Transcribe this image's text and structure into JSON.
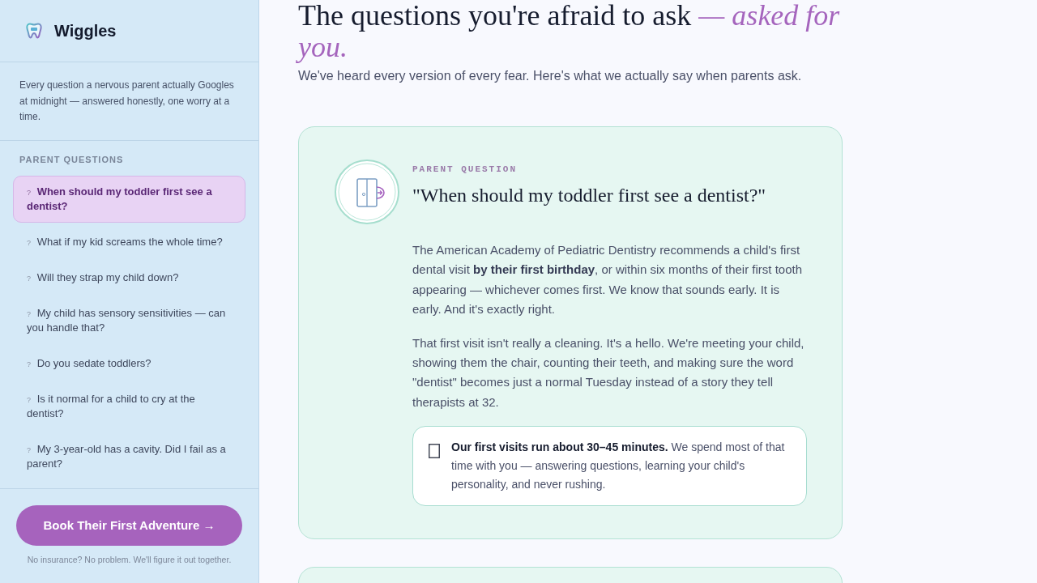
{
  "sidebar": {
    "brand": "Wiggles",
    "intro": "Every question a nervous parent actually Googles at midnight — answered honestly, one worry at a time.",
    "section_label": "PARENT QUESTIONS",
    "questions": [
      {
        "marker": "?",
        "label": "When should my toddler first see a dentist?",
        "selected": true
      },
      {
        "marker": "?",
        "label": "What if my kid screams the whole time?",
        "selected": false
      },
      {
        "marker": "?",
        "label": "Will they strap my child down?",
        "selected": false
      },
      {
        "marker": "?",
        "label": "My child has sensory sensitivities — can you handle that?",
        "selected": false
      },
      {
        "marker": "?",
        "label": "Do you sedate toddlers?",
        "selected": false
      },
      {
        "marker": "?",
        "label": "Is it normal for a child to cry at the dentist?",
        "selected": false
      },
      {
        "marker": "?",
        "label": "My 3-year-old has a cavity. Did I fail as a parent?",
        "selected": false
      }
    ],
    "cta": "Book Their First Adventure →",
    "footnote": "No insurance? No problem. We'll figure it out together."
  },
  "main": {
    "title": "The questions you're afraid to ask *— asked for you.*",
    "subtitle": "We've heard every version of every fear. Here's what we actually say when parents ask.",
    "cards": [
      {
        "eyebrow": "PARENT QUESTION",
        "question": "\"When should my toddler first see a dentist?\"",
        "paragraphs": [
          "The American Academy of Pediatric Dentistry recommends a child's first dental visit **by their first birthday**, or within six months of their first tooth appearing — whichever comes first. We know that sounds early. It is early. And it's exactly right.",
          "That first visit isn't really a cleaning. It's a hello. We're meeting your child, showing them the chair, counting their teeth, and making sure the word \"dentist\" becomes just a normal Tuesday instead of a story they tell therapists at 32."
        ],
        "callout": "**Our first visits run about 30–45 minutes.** We spend most of that time with you — answering questions, learning your child's personality, and never rushing."
      }
    ]
  }
}
